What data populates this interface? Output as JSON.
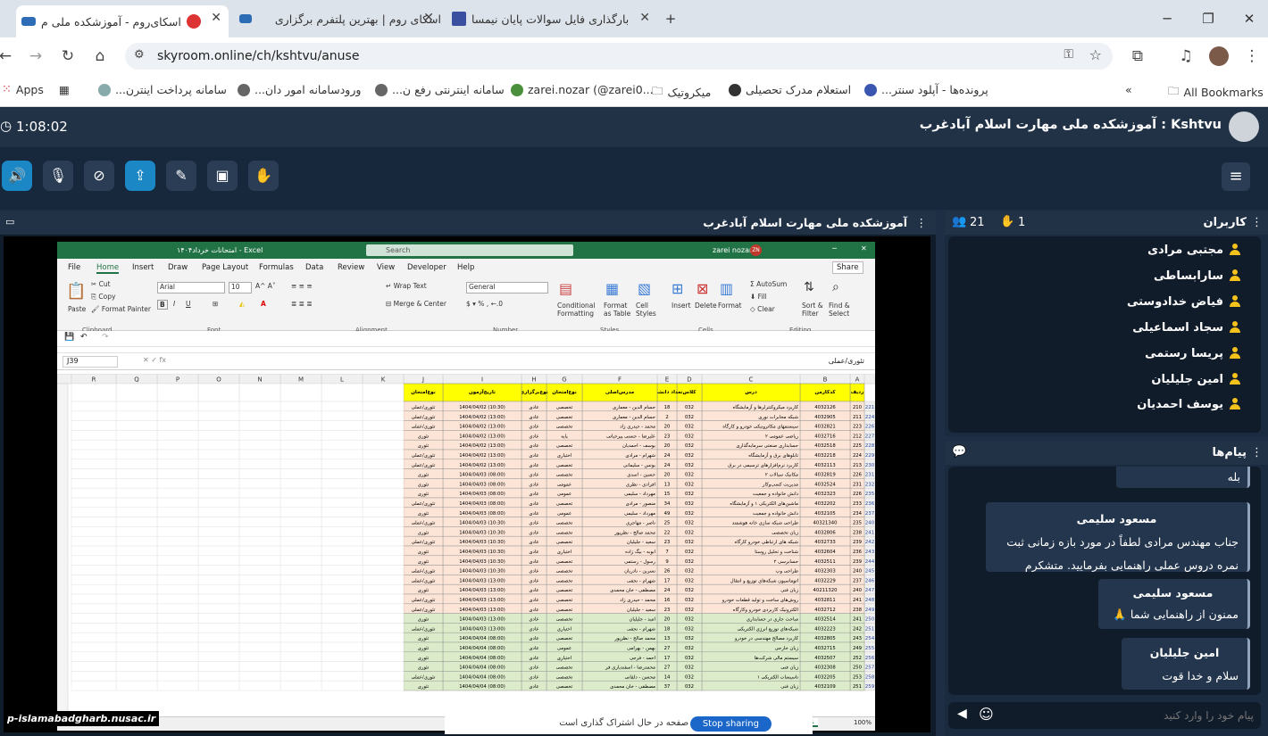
{
  "browser": {
    "tabs": [
      {
        "title": "اسکای‌روم - آموزشکده ملی م",
        "active": true
      },
      {
        "title": "اسکای روم | بهترین پلتفرم برگزاری",
        "active": false
      },
      {
        "title": "بارگذاری فایل سوالات پایان نیمسا",
        "active": false
      }
    ],
    "url": "skyroom.online/ch/kshtvu/anuse",
    "bookmarks": [
      "Apps",
      "سامانه پرداخت اینترن...",
      "ورودسامانه امور دان...",
      "سامانه اینترنتی رفع ن...",
      "zarei.nozar (@zarei0...",
      "میکروتیک",
      "استعلام مدرک تحصیلی",
      "پرونده‌ها - آپلود سنتر..."
    ],
    "all_bookmarks": "All Bookmarks",
    "colors": {
      "tabbar": "#dde3ea",
      "accent": "#1b87c4"
    }
  },
  "room": {
    "timer": "1:08:02",
    "title_user": "Kshtvu",
    "title_sep": ":",
    "title": "آموزشکده ملی مهارت اسلام آبادغرب",
    "main_title": "آموزشکده ملی مهارت اسلام آبادغرب",
    "watermark": "p-islamabadgharb.nusac.ir",
    "toolbar_icons": [
      "speaker-icon",
      "mic-off-icon",
      "camera-off-icon",
      "screen-share-icon",
      "pen-icon",
      "file-icon",
      "hand-icon"
    ]
  },
  "users": {
    "title": "کاربران",
    "hands": "1",
    "count": "21",
    "list": [
      "مجتبی مرادی",
      "سارابساطی",
      "فیاض خدادوستی",
      "سجاد اسماعیلی",
      "پریسا رستمی",
      "امین جلیلیان",
      "یوسف احمدیان"
    ]
  },
  "chat": {
    "title": "پیام‌ها",
    "messages": [
      {
        "name": "",
        "text": "بله"
      },
      {
        "name": "مسعود سلیمی",
        "text": "جناب مهندس مرادی لطفاً در مورد بازه زمانی ثبت نمره دروس عملی راهنمایی بفرمایید. متشکرم"
      },
      {
        "name": "مسعود سلیمی",
        "text": "ممنون از راهنمایی شما 🙏"
      },
      {
        "name": "امین جلیلیان",
        "text": "سلام و خدا قوت"
      }
    ],
    "input_placeholder": "پیام خود را وارد کنید"
  },
  "excel": {
    "file_title": "امتحانات خرداد۱۴۰۴ - Excel",
    "search": "Search",
    "user": "zarei nozar",
    "user_initials": "ZN",
    "menu": [
      "File",
      "Home",
      "Insert",
      "Draw",
      "Page Layout",
      "Formulas",
      "Data",
      "Review",
      "View",
      "Developer",
      "Help"
    ],
    "share": "Share",
    "font": "Arial",
    "size": "10",
    "number_format": "General",
    "ribbon_groups": [
      "Clipboard",
      "Font",
      "Alignment",
      "Number",
      "Styles",
      "Cells",
      "Editing"
    ],
    "ribbon_items": {
      "paste": "Paste",
      "cut": "Cut",
      "copy": "Copy",
      "format_painter": "Format Painter",
      "wrap": "Wrap Text",
      "merge": "Merge & Center",
      "cond": "Conditional Formatting",
      "fmt_table": "Format as Table",
      "cell_styles": "Cell Styles",
      "insert": "Insert",
      "delete": "Delete",
      "format": "Format",
      "autosum": "AutoSum",
      "fill": "Fill",
      "clear": "Clear",
      "sort": "Sort & Filter",
      "find": "Find & Select"
    },
    "name_box": "J39",
    "formula": "تئوری/عملی",
    "sheet": "Sheet1",
    "zoom": "100%",
    "columns": [
      "A",
      "B",
      "C",
      "D",
      "E",
      "F",
      "G",
      "H",
      "I",
      "J",
      "K",
      "L",
      "M",
      "N",
      "O",
      "P",
      "Q",
      "R"
    ],
    "headers": [
      "رديف",
      "کدکارمن",
      "درس",
      "کلاس",
      "تعداد دانشجو",
      "مدرس‌اصلی",
      "نوع‌امتحان",
      "نوع‌برگزاری",
      "تاريخ‌آزمون",
      "نوع‌امتحان"
    ],
    "rows": [
      [
        "221",
        "210",
        "4032126",
        "کاربرد میکروکنترلرها و آزمایشگاه",
        "032",
        "18",
        "حسام الدین - معماری",
        "تخصصی",
        "عادی",
        "1404/04/02 (10:30)",
        "تئوری/عملی"
      ],
      [
        "224",
        "211",
        "4032905",
        "شبکه مخابرات نوری",
        "032",
        "2",
        "حسام الدین - معماری",
        "تخصصی",
        "عادی",
        "1404/04/02 (13:00)",
        "تئوری/عملی"
      ],
      [
        "226",
        "223",
        "4032821",
        "سیستمهای مکاترونیکی خودرو و کارگاه",
        "032",
        "20",
        "محمد - حیدری زاد",
        "تخصصی",
        "عادی",
        "1404/04/02 (13:00)",
        "تئوری/عملی"
      ],
      [
        "227",
        "212",
        "4032716",
        "ریاضی عمومی ۲",
        "032",
        "23",
        "علیرضا - حسنی پیرخیاتی",
        "پایه",
        "عادی",
        "1404/04/02 (13:00)",
        "تئوری"
      ],
      [
        "228",
        "225",
        "4032518",
        "حسابداری صنعتی سرمایه‌گذاری",
        "032",
        "20",
        "یوسف - احمدیان",
        "تخصصی",
        "عادی",
        "1404/04/02 (13:00)",
        "تئوری"
      ],
      [
        "229",
        "224",
        "4032218",
        "تابلوهای برق و آزمایشگاه",
        "032",
        "24",
        "شهرام - مرادی",
        "اختیاری",
        "عادی",
        "1404/04/02 (13:00)",
        "تئوری/عملی"
      ],
      [
        "230",
        "213",
        "4032113",
        "کاربرد نرم‌افزارهای ترسیمی در برق",
        "032",
        "24",
        "یونس - سلیمانی",
        "تخصصی",
        "عادی",
        "1404/04/02 (13:00)",
        "تئوری/عملی"
      ],
      [
        "231",
        "226",
        "4032819",
        "مکانیک سیالات ۲",
        "032",
        "20",
        "حسین - اسدی",
        "تخصصی",
        "عادی",
        "1404/04/03 (08:00)",
        "تئوری"
      ],
      [
        "232",
        "231",
        "4032524",
        "مدیریت کسب‌وکار",
        "032",
        "13",
        "افرادی - نظری",
        "عمومی",
        "عادی",
        "1404/04/03 (08:00)",
        "تئوری"
      ],
      [
        "235",
        "226",
        "4032323",
        "دانش خانواده و جمعیت",
        "032",
        "15",
        "مهرداد - سلیمی",
        "عمومی",
        "عادی",
        "1404/04/03 (08:00)",
        "تئوری"
      ],
      [
        "236",
        "233",
        "4032202",
        "ماشین‌های الکتریکی ۱ و آزمایشگاه",
        "032",
        "34",
        "منصور - مرادی",
        "تخصصی",
        "عادی",
        "1404/04/03 (08:00)",
        "تئوری/عملی"
      ],
      [
        "237",
        "234",
        "4032105",
        "دانش خانواده و جمعیت",
        "032",
        "49",
        "مهرداد - سلیمی",
        "عمومی",
        "عادی",
        "1404/04/03 (08:00)",
        "تئوری"
      ],
      [
        "240",
        "235",
        "40321340",
        "طراحی شبکه سازی خانه هوشمند",
        "032",
        "25",
        "ناصر - مهاجری",
        "تخصصی",
        "عادی",
        "1404/04/03 (10:30)",
        "تئوری/عملی"
      ],
      [
        "241",
        "238",
        "4032806",
        "زبان تخصصی",
        "032",
        "22",
        "محمد صالح - نظرپور",
        "تخصصی",
        "عادی",
        "1404/04/03 (10:30)",
        "تئوری"
      ],
      [
        "242",
        "239",
        "4032733",
        "شبکه های ارتباطی خودرو کارگاه",
        "032",
        "23",
        "سعید - جلیلیان",
        "تخصصی",
        "عادی",
        "1404/04/03 (10:30)",
        "تئوری/عملی"
      ],
      [
        "243",
        "236",
        "4032604",
        "شناخت و تحلیل روستا",
        "032",
        "7",
        "ابوبه - بیگ زاده",
        "اختیاری",
        "عادی",
        "1404/04/03 (10:30)",
        "تئوری"
      ],
      [
        "244",
        "239",
        "4032511",
        "حسابرسی ۲",
        "032",
        "9",
        "رسول - رستمی",
        "تخصصی",
        "عادی",
        "1404/04/03 (10:30)",
        "تئوری"
      ],
      [
        "245",
        "240",
        "4032303",
        "طراحی وب",
        "032",
        "26",
        "نسرین - نادریان",
        "تخصصی",
        "عادی",
        "1404/04/03 (10:30)",
        "تئوری/عملی"
      ],
      [
        "246",
        "237",
        "4032229",
        "اتوماسیون شبکه‌های توزیع و انتقال",
        "032",
        "17",
        "شهرام - نجفی",
        "تخصصی",
        "عادی",
        "1404/04/03 (13:00)",
        "تئوری/عملی"
      ],
      [
        "247",
        "240",
        "40211320",
        "زبان فنی",
        "032",
        "24",
        "مصطفی - خان محمدی",
        "تخصصی",
        "عادی",
        "1404/04/03 (13:00)",
        "تئوری"
      ],
      [
        "248",
        "241",
        "4032811",
        "روش‌های ساخت و تولید قطعات خودرو",
        "032",
        "16",
        "محمد - حیدری زاد",
        "تخصصی",
        "عادی",
        "1404/04/03 (13:00)",
        "تئوری/عملی"
      ],
      [
        "249",
        "238",
        "4032712",
        "الکترونیک کاربردی خودرو وکارگاه",
        "032",
        "23",
        "سعید - جلیلیان",
        "تخصصی",
        "عادی",
        "1404/04/03 (13:00)",
        "تئوری/عملی"
      ],
      [
        "250",
        "241",
        "4032514",
        "مباحث جاری در حسابداری",
        "032",
        "20",
        "امید - جلیلیان",
        "تخصصی",
        "عادی",
        "1404/04/03 (13:00)",
        "تئوری"
      ],
      [
        "251",
        "242",
        "4032223",
        "شبکه‌های توزیع انرژی الکتریکی",
        "032",
        "18",
        "شهرام - نجفی",
        "اختیاری",
        "عادی",
        "1404/04/03 (13:00)",
        "تئوری/عملی"
      ],
      [
        "254",
        "243",
        "4032805",
        "کاربرد مصالح مهندسی در خودرو",
        "032",
        "13",
        "محمد صالح - نظرپور",
        "تخصصی",
        "عادی",
        "1404/04/04 (08:00)",
        "تئوری"
      ],
      [
        "255",
        "249",
        "4032715",
        "زبان خارجی",
        "032",
        "27",
        "بهمن - بهرامی",
        "عمومی",
        "عادی",
        "1404/04/04 (08:00)",
        "تئوری"
      ],
      [
        "256",
        "252",
        "4032507",
        "سیستم مالی شرکت‌ها",
        "032",
        "17",
        "احمد - فرجی",
        "اختیاری",
        "عادی",
        "1404/04/04 (08:00)",
        "تئوری"
      ],
      [
        "257",
        "250",
        "4032308",
        "زبان فنی",
        "032",
        "27",
        "محمدرضا - اسفندیاری فر",
        "تخصصی",
        "عادی",
        "1404/04/04 (08:00)",
        "تئوری"
      ],
      [
        "258",
        "253",
        "4032205",
        "تاسیسات الکتریکی ۱",
        "032",
        "14",
        "محسن - دلفانی",
        "تخصصی",
        "عادی",
        "1404/04/04 (08:00)",
        "تئوری/عملی"
      ],
      [
        "259",
        "251",
        "4032109",
        "زبان فنی",
        "032",
        "37",
        "مصطفی - خان محمدی",
        "تخصصی",
        "عادی",
        "1404/04/04 (08:00)",
        "تئوری"
      ]
    ]
  },
  "overlay": {
    "share_button": "Stop sharing",
    "share_hint": "یک صفحه در حال اشتراک گذاری است"
  }
}
